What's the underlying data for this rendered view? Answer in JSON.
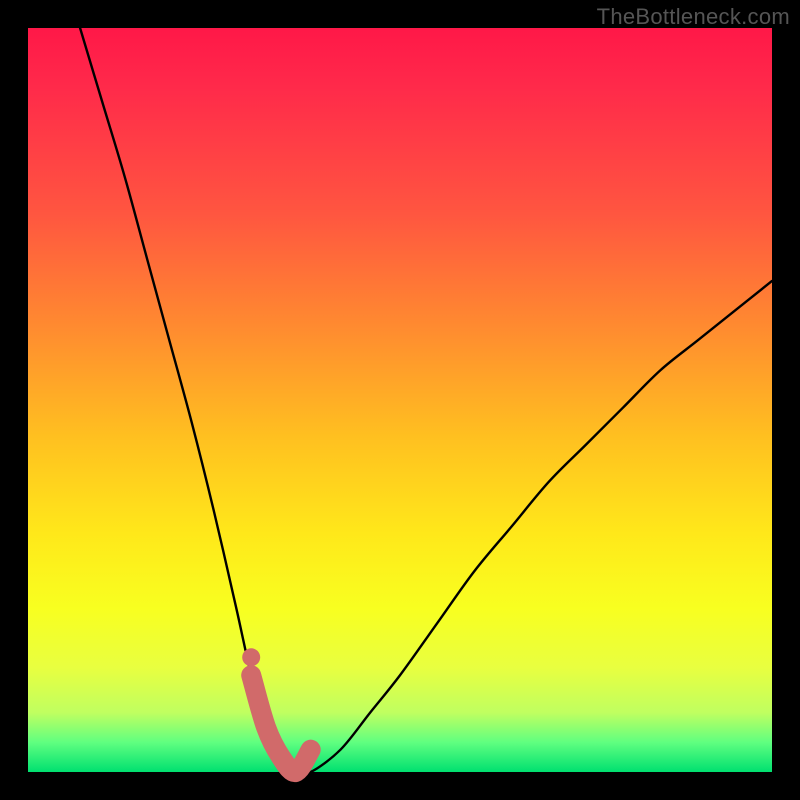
{
  "watermark": "TheBottleneck.com",
  "chart_data": {
    "type": "line",
    "title": "",
    "xlabel": "",
    "ylabel": "",
    "xlim": [
      0,
      100
    ],
    "ylim": [
      0,
      100
    ],
    "series": [
      {
        "name": "bottleneck-curve",
        "x": [
          7,
          10,
          13,
          16,
          19,
          22,
          25,
          28,
          30,
          32,
          34,
          36,
          38,
          42,
          46,
          50,
          55,
          60,
          65,
          70,
          75,
          80,
          85,
          90,
          95,
          100
        ],
        "y": [
          100,
          90,
          80,
          69,
          58,
          47,
          35,
          22,
          13,
          6,
          2,
          0,
          0,
          3,
          8,
          13,
          20,
          27,
          33,
          39,
          44,
          49,
          54,
          58,
          62,
          66
        ]
      }
    ],
    "highlight_region": {
      "name": "optimal-range",
      "x": [
        30,
        32,
        34,
        36,
        38
      ],
      "y": [
        13,
        6,
        2,
        0,
        3
      ],
      "color": "#d16a6a"
    },
    "gradient_stops": [
      {
        "pos": 0.0,
        "color": "#ff1848"
      },
      {
        "pos": 0.25,
        "color": "#ff5640"
      },
      {
        "pos": 0.55,
        "color": "#ffc020"
      },
      {
        "pos": 0.78,
        "color": "#f8ff20"
      },
      {
        "pos": 0.96,
        "color": "#60ff80"
      },
      {
        "pos": 1.0,
        "color": "#00e070"
      }
    ]
  }
}
